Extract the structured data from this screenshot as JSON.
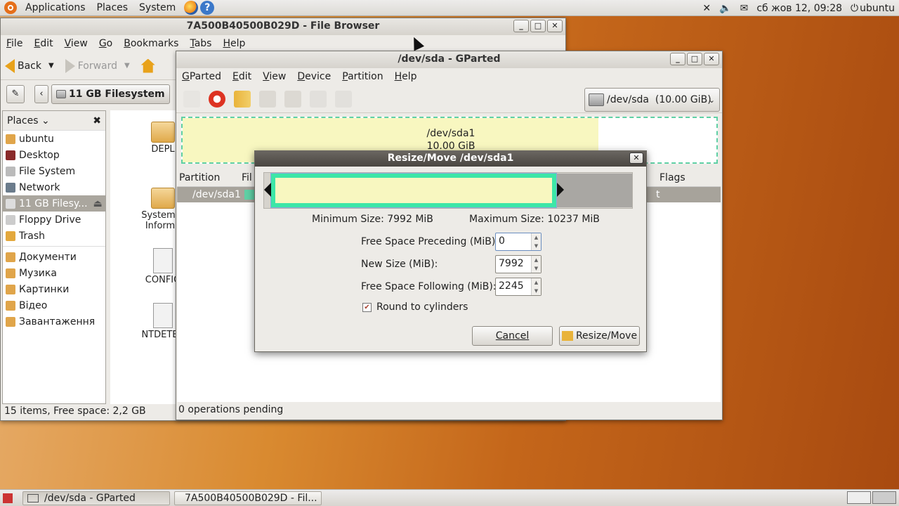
{
  "top_panel": {
    "menus": [
      "Applications",
      "Places",
      "System"
    ],
    "clock": "сб жов 12, 09:28",
    "user": "ubuntu"
  },
  "file_browser": {
    "title": "7A500B40500B029D - File Browser",
    "menus": [
      "File",
      "Edit",
      "View",
      "Go",
      "Bookmarks",
      "Tabs",
      "Help"
    ],
    "back": "Back",
    "forward": "Forward",
    "location": "11 GB Filesystem",
    "places_label": "Places",
    "places": [
      "ubuntu",
      "Desktop",
      "File System",
      "Network",
      "11 GB Filesy...",
      "Floppy Drive",
      "Trash"
    ],
    "bookmarks": [
      "Документи",
      "Музика",
      "Картинки",
      "Відео",
      "Завантаження"
    ],
    "items": [
      "DEPL",
      "System V\nInforma",
      "CONFIG",
      "NTDETEC"
    ],
    "status": "15 items, Free space: 2,2 GB"
  },
  "gparted": {
    "title": "/dev/sda - GParted",
    "menus": [
      "GParted",
      "Edit",
      "View",
      "Device",
      "Partition",
      "Help"
    ],
    "device": "/dev/sda  (10.00 GiB)",
    "vis_name": "/dev/sda1",
    "vis_size": "10.00 GiB",
    "col_partition": "Partition",
    "col_fs": "Fil",
    "col_flags": "Flags",
    "row_partition": "/dev/sda1",
    "row_tail": "t",
    "status": "0 operations pending"
  },
  "dialog": {
    "title": "Resize/Move /dev/sda1",
    "min_size": "Minimum Size: 7992 MiB",
    "max_size": "Maximum Size: 10237 MiB",
    "preceding_label": "Free Space Preceding (MiB):",
    "preceding_value": "0",
    "newsize_label": "New Size (MiB):",
    "newsize_value": "7992",
    "following_label": "Free Space Following (MiB):",
    "following_value": "2245",
    "round_label": "Round to cylinders",
    "cancel": "Cancel",
    "resize": "Resize/Move"
  },
  "taskbar": {
    "tasks": [
      "/dev/sda - GParted",
      "7A500B40500B029D - Fil..."
    ]
  }
}
